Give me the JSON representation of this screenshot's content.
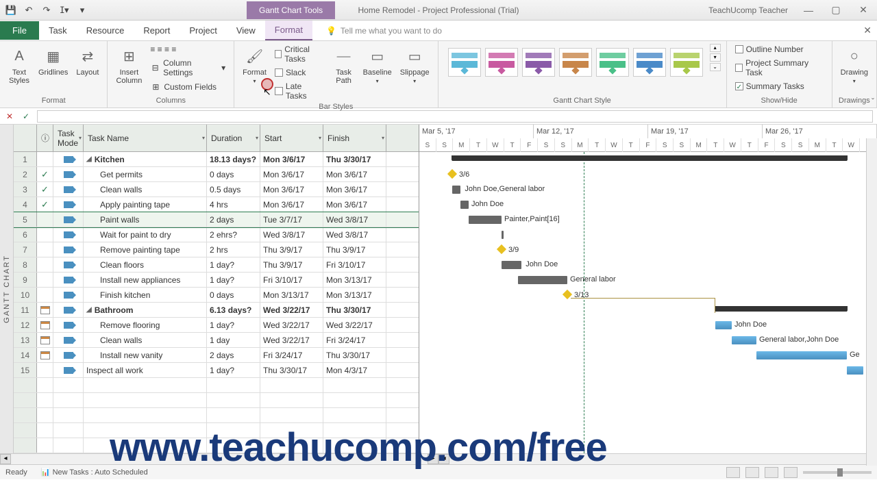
{
  "title_bar": {
    "contextual_tab": "Gantt Chart Tools",
    "doc_title": "Home Remodel  -  Project Professional (Trial)",
    "user": "TeachUcomp Teacher"
  },
  "menu": {
    "file": "File",
    "items": [
      "Task",
      "Resource",
      "Report",
      "Project",
      "View",
      "Format"
    ],
    "active": "Format",
    "tell_me": "Tell me what you want to do"
  },
  "ribbon": {
    "format": {
      "text_styles": "Text\nStyles",
      "gridlines": "Gridlines",
      "layout": "Layout",
      "label": "Format"
    },
    "columns": {
      "insert_column": "Insert\nColumn",
      "column_settings": "Column Settings",
      "custom_fields": "Custom Fields",
      "label": "Columns"
    },
    "bar_styles": {
      "format_btn": "Format",
      "critical": "Critical Tasks",
      "slack": "Slack",
      "late": "Late Tasks",
      "task_path": "Task\nPath",
      "baseline": "Baseline",
      "slippage": "Slippage",
      "label": "Bar Styles"
    },
    "gantt_style": {
      "label": "Gantt Chart Style"
    },
    "show_hide": {
      "outline_number": "Outline Number",
      "project_summary": "Project Summary Task",
      "summary_tasks": "Summary Tasks",
      "label": "Show/Hide"
    },
    "drawings": {
      "drawing": "Drawing",
      "label": "Drawings"
    }
  },
  "columns_hdr": {
    "task_mode": "Task\nMode",
    "task_name": "Task Name",
    "duration": "Duration",
    "start": "Start",
    "finish": "Finish"
  },
  "timeline": {
    "weeks": [
      "Mar 5, '17",
      "Mar 12, '17",
      "Mar 19, '17",
      "Mar 26, '17"
    ],
    "days": [
      "S",
      "S",
      "M",
      "T",
      "W",
      "T",
      "F",
      "S",
      "S",
      "M",
      "T",
      "W",
      "T",
      "F",
      "S",
      "S",
      "M",
      "T",
      "W",
      "T",
      "F",
      "S",
      "S",
      "M",
      "T",
      "W",
      "T"
    ]
  },
  "rows": [
    {
      "n": "1",
      "ind": "",
      "mode": "auto",
      "name": "Kitchen",
      "dur": "18.13 days?",
      "start": "Mon 3/6/17",
      "finish": "Thu 3/30/17",
      "summary": true,
      "indent": 0
    },
    {
      "n": "2",
      "ind": "check",
      "mode": "auto",
      "name": "Get permits",
      "dur": "0 days",
      "start": "Mon 3/6/17",
      "finish": "Mon 3/6/17",
      "indent": 1
    },
    {
      "n": "3",
      "ind": "check",
      "mode": "auto",
      "name": "Clean walls",
      "dur": "0.5 days",
      "start": "Mon 3/6/17",
      "finish": "Mon 3/6/17",
      "indent": 1
    },
    {
      "n": "4",
      "ind": "check",
      "mode": "auto",
      "name": "Apply painting tape",
      "dur": "4 hrs",
      "start": "Mon 3/6/17",
      "finish": "Mon 3/6/17",
      "indent": 1
    },
    {
      "n": "5",
      "ind": "",
      "mode": "auto",
      "name": "Paint walls",
      "dur": "2 days",
      "start": "Tue 3/7/17",
      "finish": "Wed 3/8/17",
      "indent": 1,
      "selected": true
    },
    {
      "n": "6",
      "ind": "",
      "mode": "auto",
      "name": "Wait for paint to dry",
      "dur": "2 ehrs?",
      "start": "Wed 3/8/17",
      "finish": "Wed 3/8/17",
      "indent": 1
    },
    {
      "n": "7",
      "ind": "",
      "mode": "auto",
      "name": "Remove painting tape",
      "dur": "2 hrs",
      "start": "Thu 3/9/17",
      "finish": "Thu 3/9/17",
      "indent": 1
    },
    {
      "n": "8",
      "ind": "",
      "mode": "auto",
      "name": "Clean floors",
      "dur": "1 day?",
      "start": "Thu 3/9/17",
      "finish": "Fri 3/10/17",
      "indent": 1
    },
    {
      "n": "9",
      "ind": "",
      "mode": "auto",
      "name": "Install new appliances",
      "dur": "1 day?",
      "start": "Fri 3/10/17",
      "finish": "Mon 3/13/17",
      "indent": 1
    },
    {
      "n": "10",
      "ind": "",
      "mode": "auto",
      "name": "Finish kitchen",
      "dur": "0 days",
      "start": "Mon 3/13/17",
      "finish": "Mon 3/13/17",
      "indent": 1
    },
    {
      "n": "11",
      "ind": "cal",
      "mode": "auto",
      "name": "Bathroom",
      "dur": "6.13 days?",
      "start": "Wed 3/22/17",
      "finish": "Thu 3/30/17",
      "summary": true,
      "indent": 0
    },
    {
      "n": "12",
      "ind": "cal",
      "mode": "auto",
      "name": "Remove flooring",
      "dur": "1 day?",
      "start": "Wed 3/22/17",
      "finish": "Wed 3/22/17",
      "indent": 1
    },
    {
      "n": "13",
      "ind": "cal",
      "mode": "auto",
      "name": "Clean walls",
      "dur": "1 day",
      "start": "Wed 3/22/17",
      "finish": "Fri 3/24/17",
      "indent": 1
    },
    {
      "n": "14",
      "ind": "cal",
      "mode": "auto",
      "name": "Install new vanity",
      "dur": "2 days",
      "start": "Fri 3/24/17",
      "finish": "Thu 3/30/17",
      "indent": 1
    },
    {
      "n": "15",
      "ind": "",
      "mode": "auto",
      "name": "Inspect all work",
      "dur": "1 day?",
      "start": "Thu 3/30/17",
      "finish": "Mon 4/3/17",
      "indent": 0
    }
  ],
  "gantt_labels": {
    "r2": "3/6",
    "r3": "John Doe,General labor",
    "r4": "John Doe",
    "r5": "Painter,Paint[16]",
    "r7": "3/9",
    "r8": "John Doe",
    "r9": "General labor",
    "r10": "3/13",
    "r12": "John Doe",
    "r13": "General labor,John Doe",
    "r14": "Ge"
  },
  "status": {
    "ready": "Ready",
    "new_tasks": "New Tasks : Auto Scheduled"
  },
  "side_label": "GANTT CHART",
  "watermark": "www.teachucomp.com/free",
  "style_colors": [
    "#5bb8d8",
    "#c85aa0",
    "#8a5aa8",
    "#c8864a",
    "#4ac088",
    "#4a8ac8",
    "#a8c84a"
  ]
}
